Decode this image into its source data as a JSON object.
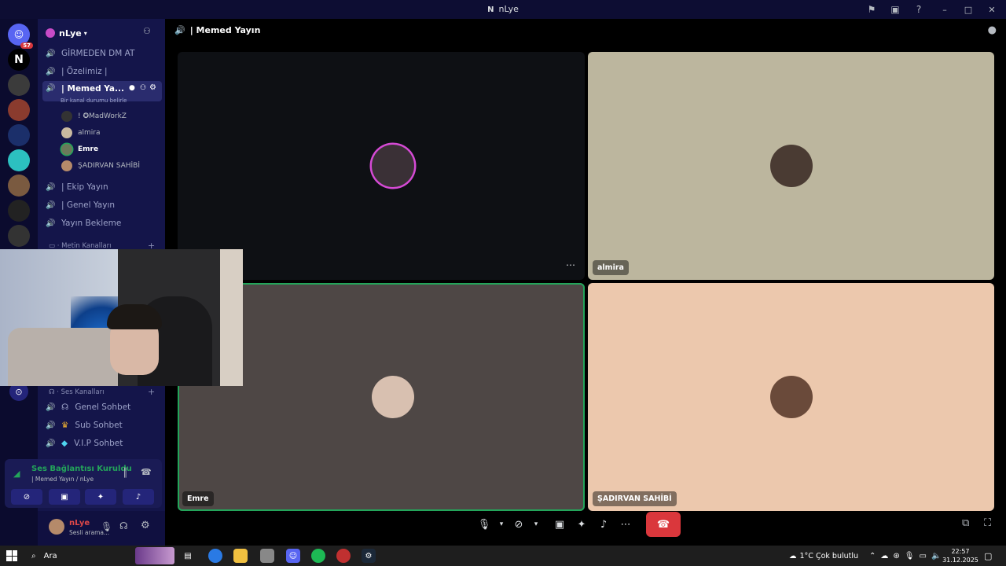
{
  "window": {
    "title": "nLye",
    "logo": "N"
  },
  "titlebar_icons": [
    "inbox-icon",
    "window-icon",
    "help-icon"
  ],
  "servers": {
    "badge": "57"
  },
  "guild": {
    "name": "nLye"
  },
  "channels": {
    "voice_top": [
      {
        "label": "GİRMEDEN DM AT"
      },
      {
        "label": "| Özelimiz |"
      },
      {
        "label": "| Memed Ya...",
        "status_hint": "Bir kanal durumu belirle"
      },
      {
        "label": "| Ekip Yayın"
      },
      {
        "label": "| Genel Yayın"
      },
      {
        "label": "Yayın Bekleme"
      }
    ],
    "members": [
      {
        "name": "! ✪MadWorkZ"
      },
      {
        "name": "almira"
      },
      {
        "name": "Emre"
      },
      {
        "name": "ŞADIRVAN SAHİBİ"
      }
    ],
    "text_category": "Metin Kanalları",
    "voice_category": "Ses Kanalları",
    "voice_bottom": [
      {
        "label": "Genel Sohbet"
      },
      {
        "label": "Sub Sohbet"
      },
      {
        "label": "V.I.P Sohbet"
      }
    ]
  },
  "voice_panel": {
    "title": "Ses Bağlantısı Kuruldu",
    "subtitle": "| Memed Yayın / nLye"
  },
  "user_panel": {
    "name": "nLye",
    "status": "Sesli arama..."
  },
  "main": {
    "header": "| Memed Yayın",
    "tiles": [
      {
        "label": "",
        "bg": "#0e1014"
      },
      {
        "label": "almira",
        "bg": "#bcb69e"
      },
      {
        "label": "Emre",
        "bg": "#4e4745"
      },
      {
        "label": "ŞADIRVAN SAHİBİ",
        "bg": "#ecc8ad"
      }
    ]
  },
  "taskbar": {
    "search_placeholder": "Ara",
    "weather": "1°C  Çok bulutlu",
    "time": "22:57",
    "date": "31.12.2025"
  },
  "colors": {
    "accent": "#5865f2",
    "danger": "#da373c",
    "connected": "#23a55a"
  }
}
